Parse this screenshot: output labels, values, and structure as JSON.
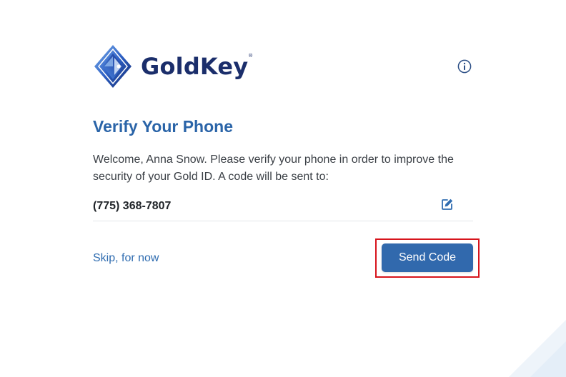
{
  "brand": {
    "name": "GoldKey",
    "registered_mark": "®",
    "colors": {
      "primary": "#2a64a8",
      "button": "#3169ad",
      "logo_text": "#1b2e6b",
      "highlight": "#d7141c"
    }
  },
  "header": {
    "info_icon": "info-circle-icon"
  },
  "verify": {
    "title": "Verify Your Phone",
    "message": "Welcome, Anna Snow. Please verify your phone in order to improve the security of your Gold ID. A code will be sent to:",
    "phone_number": "(775) 368-7807",
    "edit_icon": "edit-icon"
  },
  "actions": {
    "skip_label": "Skip, for now",
    "send_code_label": "Send Code"
  }
}
